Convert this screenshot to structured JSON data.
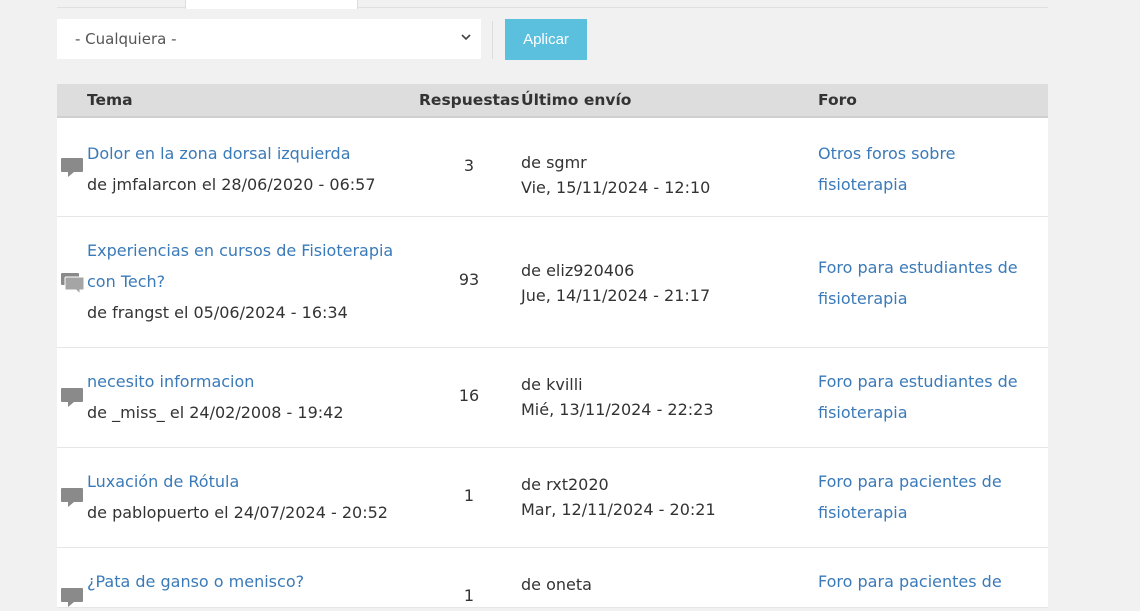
{
  "filter": {
    "select_value": "- Cualquiera -",
    "apply_label": "Aplicar"
  },
  "table": {
    "headers": {
      "tema": "Tema",
      "respuestas": "Respuestas",
      "ultimo": "Último envío",
      "foro": "Foro"
    },
    "rows": [
      {
        "title_lines": [
          "Dolor en la zona dorsal izquierda"
        ],
        "author_line": "de jmfalarcon el 28/06/2020 - 06:57",
        "replies": "3",
        "last_by": "de sgmr",
        "last_date": "Vie, 15/11/2024 - 12:10",
        "forum_lines": [
          "Otros foros sobre",
          "fisioterapia"
        ],
        "icon": "comment-icon"
      },
      {
        "title_lines": [
          "Experiencias en cursos de Fisioterapia",
          "con Tech?"
        ],
        "author_line": "de frangst el 05/06/2024 - 16:34",
        "replies": "93",
        "last_by": "de eliz920406",
        "last_date": "Jue, 14/11/2024 - 21:17",
        "forum_lines": [
          "Foro para estudiantes de",
          "fisioterapia"
        ],
        "icon": "comments-hot-icon"
      },
      {
        "title_lines": [
          "necesito informacion"
        ],
        "author_line": "de _miss_ el 24/02/2008 - 19:42",
        "replies": "16",
        "last_by": "de kvilli",
        "last_date": "Mié, 13/11/2024 - 22:23",
        "forum_lines": [
          "Foro para estudiantes de",
          "fisioterapia"
        ],
        "icon": "comment-icon"
      },
      {
        "title_lines": [
          "Luxación de Rótula"
        ],
        "author_line": "de pablopuerto el 24/07/2024 - 20:52",
        "replies": "1",
        "last_by": "de rxt2020",
        "last_date": "Mar, 12/11/2024 - 20:21",
        "forum_lines": [
          "Foro para pacientes de",
          "fisioterapia"
        ],
        "icon": "comment-icon"
      },
      {
        "title_lines": [
          "¿Pata de ganso o menisco?"
        ],
        "author_line": "",
        "replies": "1",
        "last_by": "de oneta",
        "last_date": "",
        "forum_lines": [
          "Foro para pacientes de",
          ""
        ],
        "icon": "comment-icon"
      }
    ]
  },
  "colors": {
    "link": "#3a7ab8",
    "apply_button": "#5bc0de",
    "header_bg": "#dddddd"
  }
}
